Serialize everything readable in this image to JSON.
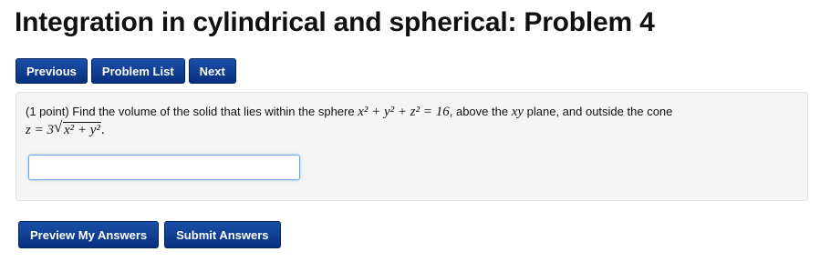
{
  "page": {
    "title": "Integration in cylindrical and spherical: Problem 4"
  },
  "nav": {
    "previous_label": "Previous",
    "problem_list_label": "Problem List",
    "next_label": "Next"
  },
  "problem": {
    "intro": "(1 point) Find the volume of the solid that lies within the sphere",
    "sphere_equation": "x² + y² + z² = 16",
    "middle_text": ", above the",
    "plane_name": "xy",
    "plane_text": "plane, and outside the cone",
    "cone_lhs": "z = 3",
    "cone_radicand": "x² + y²",
    "end": "."
  },
  "answer": {
    "value": "",
    "placeholder": ""
  },
  "actions": {
    "preview_label": "Preview My Answers",
    "submit_label": "Submit Answers"
  },
  "colors": {
    "button_blue": "#0a3b8f",
    "box_background": "#f5f5f5",
    "input_focus_border": "#6aa7e6"
  }
}
